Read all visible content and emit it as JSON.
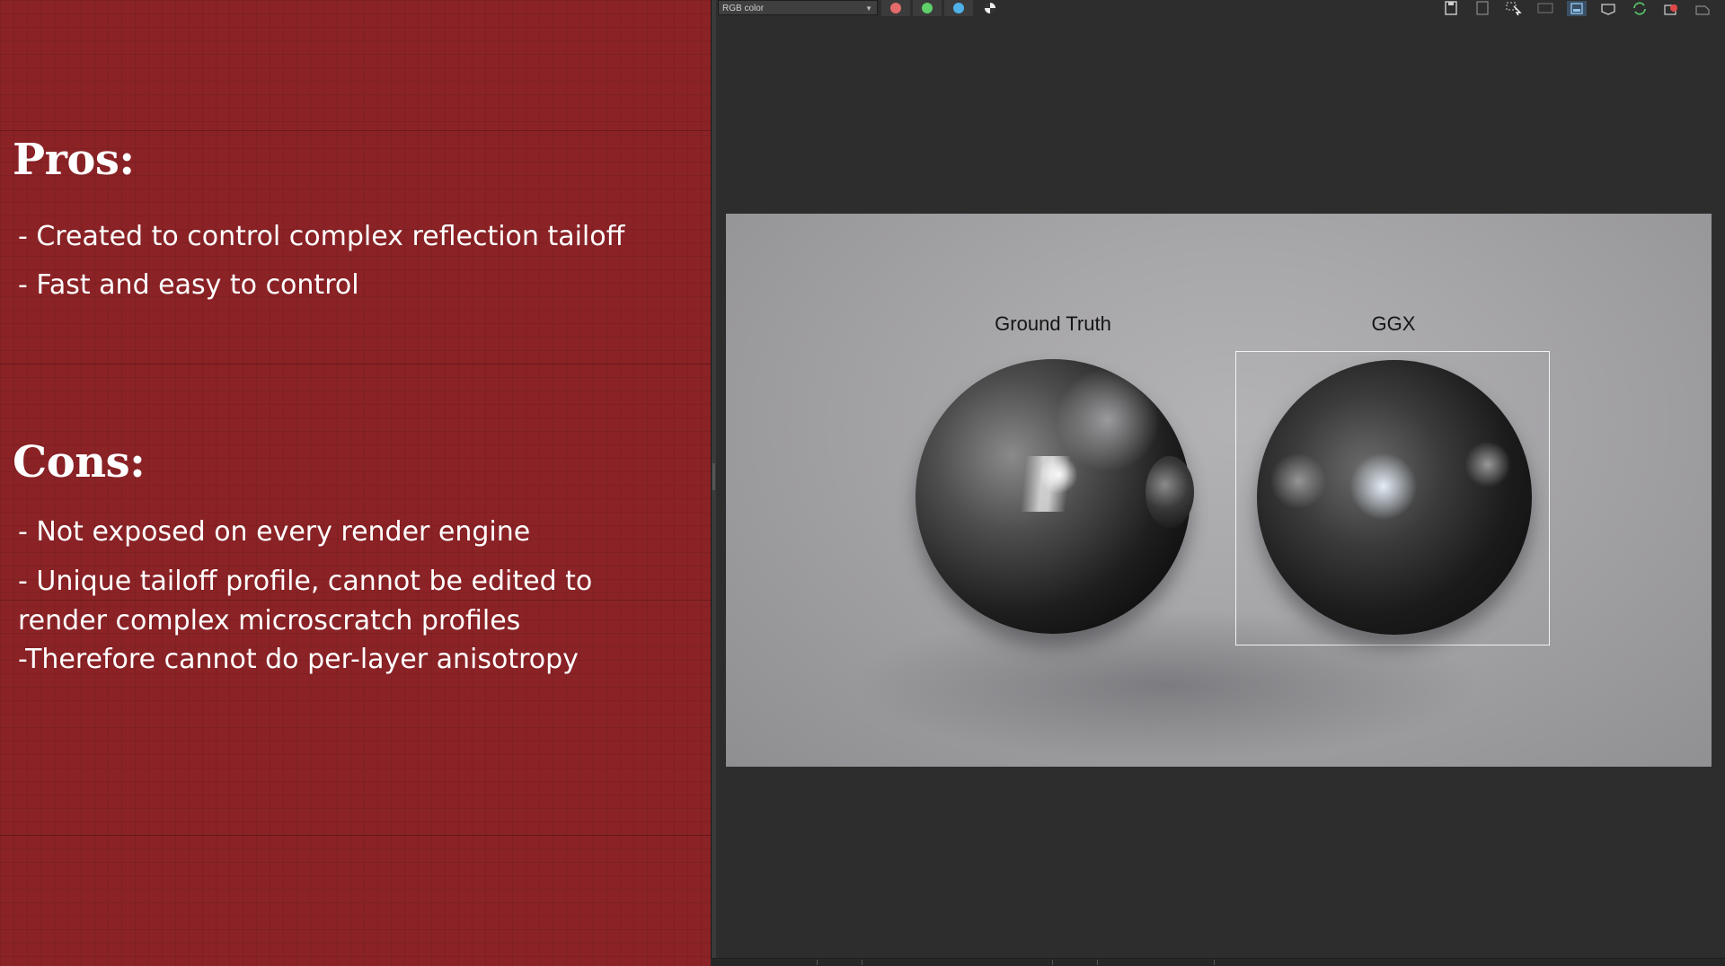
{
  "slide": {
    "pros_heading": "Pros:",
    "pros": [
      "- Created to control complex reflection tailoff",
      "- Fast and easy to control"
    ],
    "cons_heading": "Cons:",
    "cons": [
      "- Not exposed on every render engine",
      "- Unique tailoff profile, cannot be edited to render complex microscratch profiles",
      "-Therefore cannot do per-layer anisotropy"
    ],
    "background_color": "#8a2226"
  },
  "viewer": {
    "channel_select": {
      "value": "RGB color"
    },
    "channels": [
      {
        "name": "red-channel",
        "color": "#e36b6b"
      },
      {
        "name": "green-channel",
        "color": "#5fcf6a"
      },
      {
        "name": "blue-channel",
        "color": "#4fb1e8"
      },
      {
        "name": "alpha-channel",
        "color": "#e8e8e8"
      }
    ],
    "toolbar_icons": [
      "save-icon",
      "save-all-icon",
      "region-render-icon",
      "3d-icon",
      "frame-buffer-icon",
      "track-mouse-icon",
      "refresh-icon",
      "stop-render-icon",
      "lock-icon"
    ],
    "render": {
      "label_left": "Ground Truth",
      "label_right": "GGX"
    }
  }
}
